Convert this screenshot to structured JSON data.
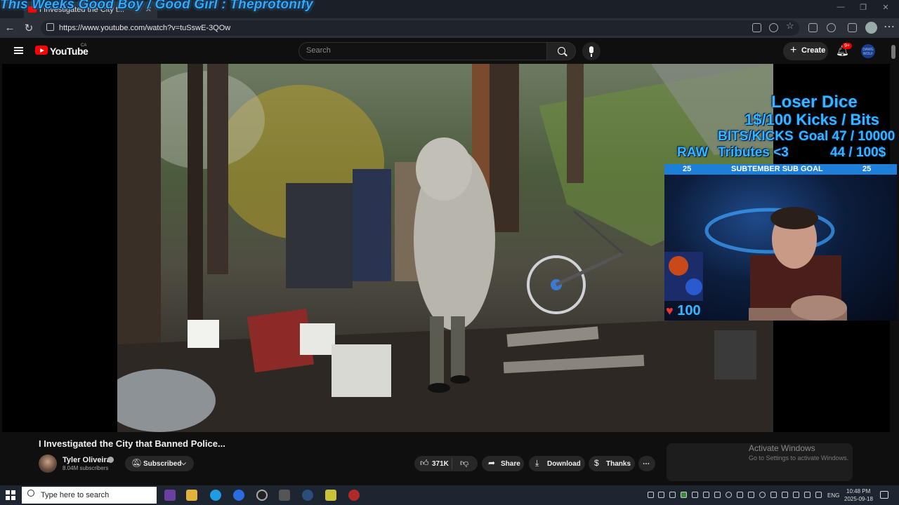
{
  "browser": {
    "tab_title": "I Investigated the City t...",
    "url": "https://www.youtube.com/watch?v=tuSswE-3QOw"
  },
  "stream_overlay": {
    "title": "This Weeks Good Boy / Good Girl : Theprotonify",
    "dice_title": "Loser Dice",
    "line_kicks": "1$/100 Kicks / Bits",
    "line_goal_label": "BITS/KICKS",
    "line_goal_value": "Goal 47 / 10000",
    "line_tributes_prefix": "RAW",
    "line_tributes_label": "Tributes <3",
    "line_tributes_value": "44 / 100$",
    "subgoal_label": "SUBTEMBER SUB GOAL",
    "subgoal_left": "25",
    "subgoal_right": "25",
    "hearts_count": "100"
  },
  "youtube": {
    "logo_text": "YouTube",
    "country": "CA",
    "search_placeholder": "Search",
    "create_label": "Create",
    "notif_badge": "9+",
    "avatar_text": "DAWG WOLF"
  },
  "video": {
    "title": "I Investigated the City that Banned Police...",
    "channel": "Tyler Oliveira",
    "subscribers": "8.04M subscribers",
    "subscribed_label": "Subscribed",
    "likes": "371K",
    "share_label": "Share",
    "download_label": "Download",
    "thanks_label": "Thanks"
  },
  "windows": {
    "activate_title": "Activate Windows",
    "activate_sub": "Go to Settings to activate Windows.",
    "search_placeholder": "Type here to search",
    "lang": "ENG",
    "time": "10:48 PM",
    "date": "2025-09-18"
  },
  "colors": {
    "overlay_blue": "#35b6ff",
    "subgoal_bar": "#1e7fd8",
    "yt_red": "#ff0000"
  }
}
